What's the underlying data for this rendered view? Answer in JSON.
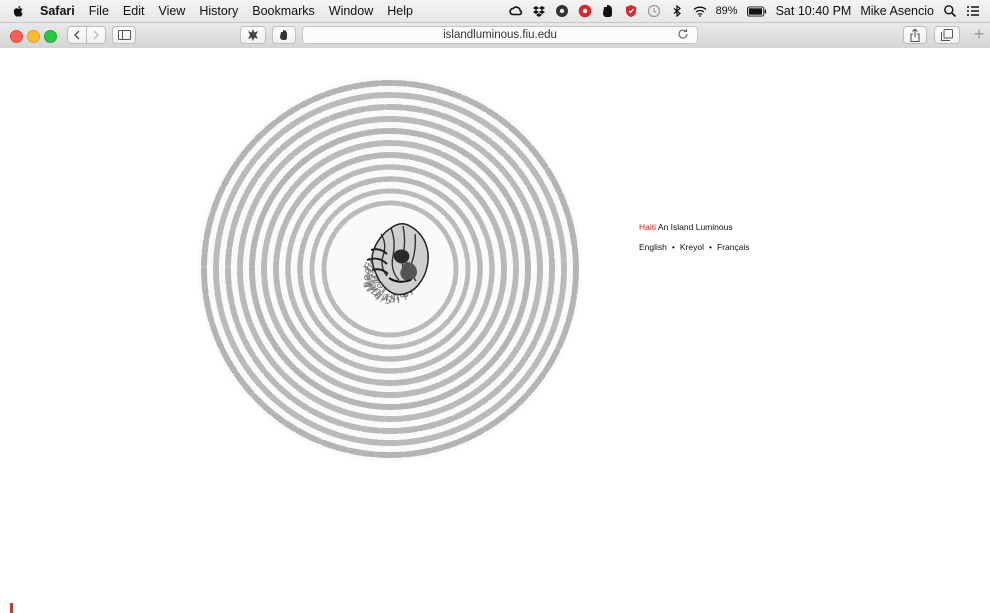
{
  "menubar": {
    "app_name": "Safari",
    "menus": [
      "File",
      "Edit",
      "View",
      "History",
      "Bookmarks",
      "Window",
      "Help"
    ],
    "battery": "89%",
    "clock": "Sat 10:40 PM",
    "user": "Mike Asencio",
    "status_icons": [
      "creative-cloud-icon",
      "dropbox-icon",
      "privacy-icon",
      "lastpass-icon",
      "evernote-icon",
      "shield-icon",
      "time-machine-icon",
      "bluetooth-icon",
      "wifi-icon",
      "battery-icon",
      "spotlight-icon",
      "notification-center-icon"
    ]
  },
  "browser": {
    "url": "islandluminous.fiu.edu"
  },
  "page": {
    "brand_highlight": "Haiti",
    "brand_rest": "An Island Luminous",
    "languages": [
      "English",
      "Kreyol",
      "Français"
    ],
    "separator": "•",
    "spiral_text": "Glodel Mezilas · Mark Schuller · Kathy Bhatia · Sibylle Fischer · Gerald Ivy · Madison Smartt Bell · Gerdès Fleurant · Jennifer Brown · Kate Ramsey · Leon Pamphile · Ibrahim Kitchens · Antoine Payton · Claire Jenkins · Matthew Clavin · Jean-François Brière · Paul Lachance · Nicholas Johnson · Matthew J. Smith · Dolores Jenkins · Chelsea Stieber · Robert Fatton · Anne Eller · Chantalle Verna · Rebecca Dirksen · Michel Hector · Daniel Largey · Nathalie Pierre · Marc Prou · Martin Munro · Grete Viddal · Mimi Sheller · Bernard Diederich · Hubert Lemaire · Roberto Paul · Asselin Charles · Caroline Rowe · Carlos Sosa · Daniel Glover · Graham Nessler · Laurent Dubois · Celucien Joseph · Cole Raines · Keith Holloway · Kate Kerzner · Michel Gabriel · Joanne Dorsey · Hubert Carter · Nicholas Jude · Claire Payne · Edward Garcia · Stephen Hack · Daniel Cary · Marcus Derby · Kenneth Pierre"
  }
}
